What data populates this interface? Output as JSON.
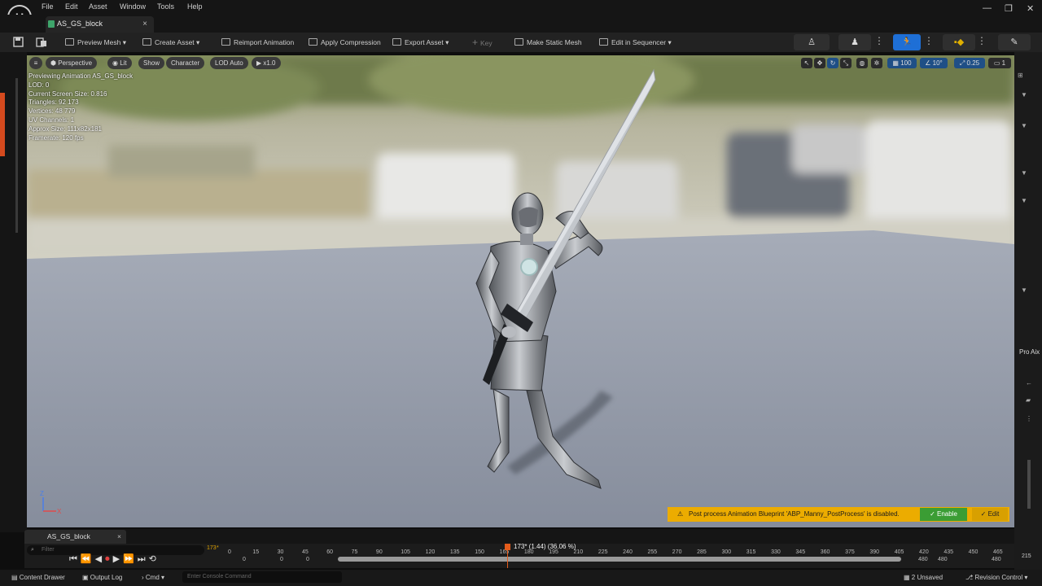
{
  "menu": {
    "items": [
      "File",
      "Edit",
      "Asset",
      "Window",
      "Tools",
      "Help"
    ]
  },
  "window": {
    "minimize": "—",
    "maximize": "❐",
    "close": "✕"
  },
  "tab": {
    "title": "AS_GS_block",
    "close": "×"
  },
  "toolbar": {
    "preview_mesh": "Preview Mesh",
    "create_asset": "Create Asset",
    "reimport": "Reimport Animation",
    "apply_compression": "Apply Compression",
    "export_asset": "Export Asset",
    "key": "Key",
    "make_static_mesh": "Make Static Mesh",
    "edit_in_sequencer": "Edit in Sequencer"
  },
  "viewport_toolbar": {
    "perspective": "Perspective",
    "lit": "Lit",
    "show": "Show",
    "character": "Character",
    "lod": "LOD Auto",
    "speed": "x1.0",
    "grid_value": "100",
    "angle_value": "10°",
    "scale_value": "0.25",
    "camera_value": "1"
  },
  "stats": {
    "line1": "Previewing Animation AS_GS_block",
    "line2": "LOD: 0",
    "line3": "Current Screen Size: 0.816",
    "line4": "Triangles: 92 173",
    "line5": "Vertices: 48 779",
    "line6": "UV Channels: 1",
    "line7": "Approx Size: 111x82x181",
    "line8": "Framerate: 120 fps"
  },
  "notification": {
    "message": "Post process Animation Blueprint 'ABP_Manny_PostProcess' is disabled.",
    "enable": "Enable",
    "edit": "Edit"
  },
  "sequencer": {
    "tab": "AS_GS_block",
    "filter_placeholder": "Filter",
    "frame_field": "173",
    "playhead_label": "173* (1.44) (36.06 %)",
    "ticks": [
      "0",
      "15",
      "30",
      "45",
      "60",
      "75",
      "90",
      "105",
      "120",
      "135",
      "150",
      "165",
      "180",
      "195",
      "210",
      "225",
      "240",
      "255",
      "270",
      "285",
      "300",
      "315",
      "330",
      "345",
      "360",
      "375",
      "390",
      "405",
      "420",
      "435",
      "450",
      "465"
    ],
    "under_ticks": [
      "0",
      "0",
      "0",
      "480",
      "480",
      "480"
    ],
    "end_label": "215"
  },
  "statusbar": {
    "content_drawer": "Content Drawer",
    "output_log": "Output Log",
    "cmd": "Cmd",
    "console_placeholder": "Enter Console Command",
    "unsaved": "2 Unsaved",
    "revision_control": "Revision Control"
  },
  "right_panel": {
    "label": "Pro",
    "label2": "Aix"
  }
}
